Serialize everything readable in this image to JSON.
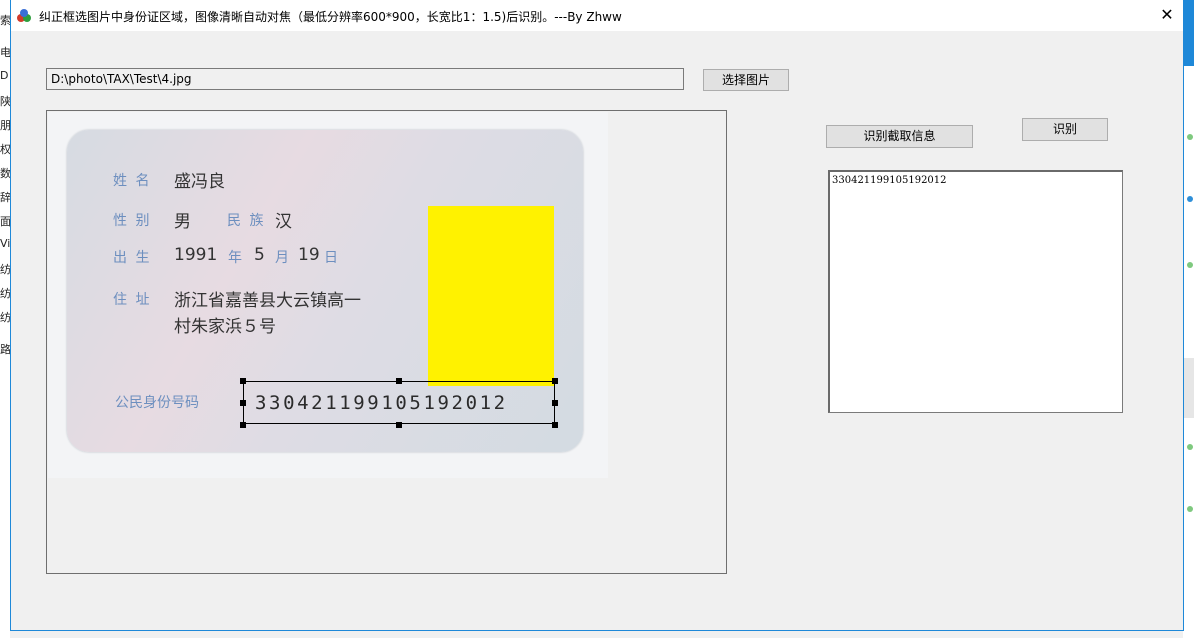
{
  "window": {
    "title": "纠正框选图片中身份证区域，图像清晰自动对焦（最低分辨率600*900，长宽比1：1.5)后识别。---By    Zhww",
    "close_glyph": "✕"
  },
  "file": {
    "path": "D:\\photo\\TAX\\Test\\4.jpg",
    "select_button": "选择图片"
  },
  "actions": {
    "crop_info_button": "识别截取信息",
    "recognize_button": "识别"
  },
  "result": {
    "text": "330421199105192012"
  },
  "id_card": {
    "name_label": "姓 名",
    "name": "盛冯良",
    "gender_label": "性 别",
    "gender": "男",
    "ethnicity_label": "民 族",
    "ethnicity": "汉",
    "birth_label": "出 生",
    "birth_year": "1991",
    "year_unit": "年",
    "birth_month": "5",
    "month_unit": "月",
    "birth_day": "19",
    "day_unit": "日",
    "address_label": "住 址",
    "address_line1": "浙江省嘉善县大云镇高一",
    "address_line2": "村朱家浜５号",
    "id_label": "公民身份号码",
    "id_number": "330421199105192012"
  },
  "background_app": {
    "left_fragments": [
      "索",
      "电",
      "D",
      "陕",
      "朋",
      "权",
      "数",
      "辞",
      "面",
      "Vi",
      "纺",
      "纺",
      "纺",
      "路"
    ]
  },
  "colors": {
    "accent": "#1e88d8",
    "photo_mask": "#fff200",
    "card_label": "#6d8fbf"
  }
}
